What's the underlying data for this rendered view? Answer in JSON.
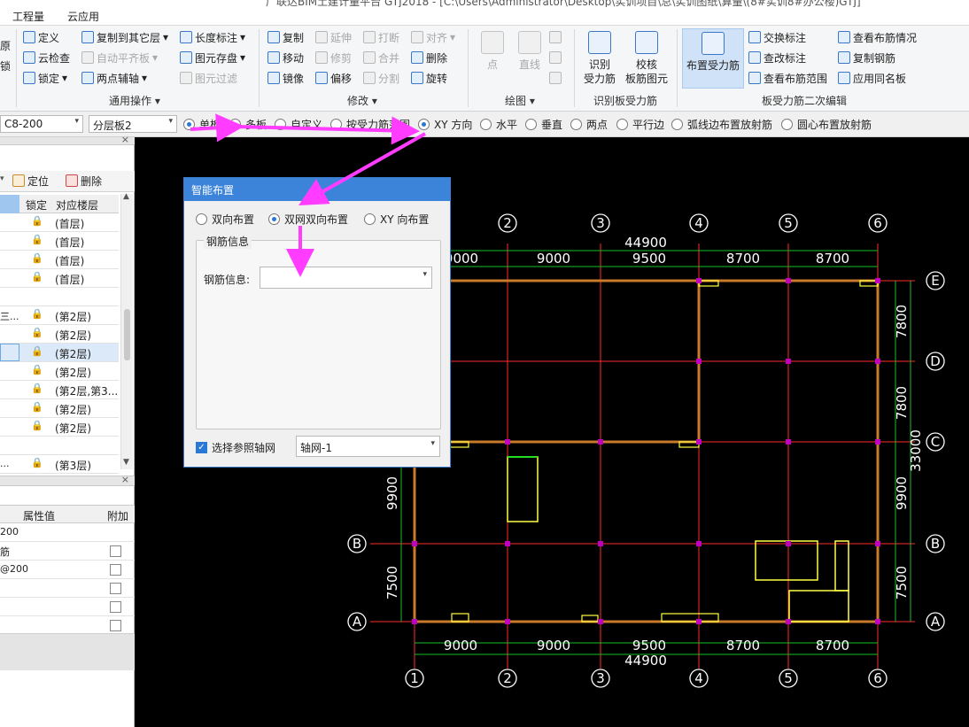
{
  "window_title": "广联达BIM土建计量平台 GTJ2018 - [C:\\Users\\Administrator\\Desktop\\实训项目\\总\\实训图纸\\算量\\(8#实训8#办公楼)GTJ]",
  "menu": {
    "items": [
      "工程量",
      "云应用"
    ]
  },
  "ribbon": {
    "left_edge": {
      "t1": "原",
      "t2": "锁"
    },
    "general": {
      "define": "定义",
      "copy_to_floor": "复制到其它层",
      "length_mark": "长度标注",
      "cloud_check": "云检查",
      "auto_flat_slab": "自动平齐板",
      "element_save": "图元存盘",
      "lock": "锁定",
      "two_point_axis": "两点辅轴",
      "element_filter": "图元过滤",
      "group_label": "通用操作"
    },
    "modify": {
      "copy": "复制",
      "extend": "延伸",
      "break": "打断",
      "align": "对齐",
      "move": "移动",
      "trim": "修剪",
      "merge": "合并",
      "delete": "删除",
      "mirror": "镜像",
      "offset": "偏移",
      "split": "分割",
      "rotate": "旋转",
      "group_label": "修改"
    },
    "draw": {
      "point": "点",
      "line": "直线",
      "group_label": "绘图"
    },
    "identify": {
      "identify_rebar_l1": "识别",
      "identify_rebar_l2": "受力筋",
      "check_l1": "校核",
      "check_l2": "板筋图元",
      "group_label": "识别板受力筋"
    },
    "secondary": {
      "place_rebar": "布置受力筋",
      "swap_mark": "交换标注",
      "view_layout": "查看布筋情况",
      "check_mark": "查改标注",
      "copy_rebar": "复制钢筋",
      "view_range": "查看布筋范围",
      "apply_same_name": "应用同名板",
      "group_label": "板受力筋二次编辑"
    }
  },
  "options": {
    "combo1": "C8-200",
    "combo2": "分层板2",
    "radios": [
      {
        "label": "单板",
        "checked": true
      },
      {
        "label": "多板",
        "checked": false
      },
      {
        "label": "自定义",
        "checked": false
      },
      {
        "label": "按受力筋范围",
        "checked": false
      },
      {
        "label": "XY 方向",
        "checked": true
      },
      {
        "label": "水平",
        "checked": false
      },
      {
        "label": "垂直",
        "checked": false
      },
      {
        "label": "两点",
        "checked": false
      },
      {
        "label": "平行边",
        "checked": false
      },
      {
        "label": "弧线边布置放射筋",
        "checked": false
      },
      {
        "label": "圆心布置放射筋",
        "checked": false
      }
    ]
  },
  "left_panel": {
    "locate": "定位",
    "delete": "删除",
    "col_lock": "锁定",
    "col_floor": "对应楼层",
    "rows": [
      {
        "name": "",
        "floor": "(首层)"
      },
      {
        "name": "",
        "floor": "(首层)"
      },
      {
        "name": "",
        "floor": "(首层)"
      },
      {
        "name": "",
        "floor": "(首层)"
      },
      {
        "name": "",
        "floor": ""
      },
      {
        "name": "三...",
        "floor": "(第2层)"
      },
      {
        "name": "",
        "floor": "(第2层)"
      },
      {
        "name": "",
        "floor": "(第2层)"
      },
      {
        "name": "",
        "floor": "(第2层)"
      },
      {
        "name": "",
        "floor": "(第2层,第3..."
      },
      {
        "name": "",
        "floor": "(第2层)"
      },
      {
        "name": "",
        "floor": "(第2层)"
      },
      {
        "name": "",
        "floor": ""
      },
      {
        "name": "...",
        "floor": "(第3层)"
      }
    ],
    "props": {
      "col_value": "属性值",
      "col_extra": "附加",
      "rows": [
        "200",
        "筋",
        "@200",
        "",
        "",
        ""
      ]
    }
  },
  "dialog": {
    "title": "智能布置",
    "opt1": "双向布置",
    "opt2": "双网双向布置",
    "opt3": "XY 向布置",
    "selected": "双网双向布置",
    "group_label": "钢筋信息",
    "field_label": "钢筋信息:",
    "field_value": "",
    "ref_axis_label": "选择参照轴网",
    "ref_axis_checked": true,
    "ref_axis_value": "轴网-1"
  },
  "cad": {
    "columns": [
      "1",
      "2",
      "3",
      "4",
      "5",
      "6"
    ],
    "rows": [
      "A",
      "B",
      "C",
      "D",
      "E"
    ],
    "top_dims": [
      "9000",
      "9000",
      "9500",
      "8700",
      "8700"
    ],
    "bottom_dims": [
      "9000",
      "9000",
      "9500",
      "8700",
      "8700"
    ],
    "total_x": "44900",
    "right_dims": [
      "7500",
      "9900",
      "7800",
      "7800"
    ],
    "left_dims": [
      "7500",
      "9900"
    ],
    "total_y": "33000",
    "colors": {
      "grid": "#ff2a2a",
      "dim": "#19c12a",
      "wall": "#ffff44",
      "beam": "#c97a2a",
      "column": "#c000c0"
    }
  }
}
